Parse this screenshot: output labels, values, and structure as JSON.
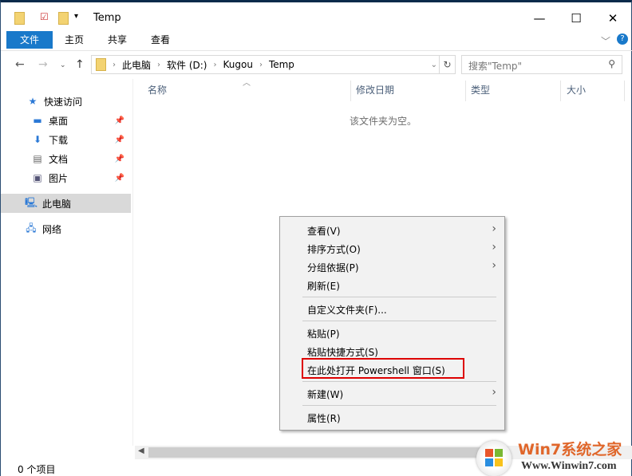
{
  "window": {
    "title": "Temp",
    "minimize": "—",
    "maximize": "☐",
    "close": "✕"
  },
  "ribbon": {
    "tabs": [
      "文件",
      "主页",
      "共享",
      "查看"
    ],
    "expand": "﹀",
    "help": "?"
  },
  "address": {
    "crumbs": [
      "此电脑",
      "软件 (D:)",
      "Kugou",
      "Temp"
    ],
    "search_placeholder": "搜索\"Temp\""
  },
  "sidebar": {
    "items": [
      {
        "label": "快速访问",
        "icon": "star-icon"
      },
      {
        "label": "桌面",
        "icon": "desktop-icon",
        "pinned": true
      },
      {
        "label": "下载",
        "icon": "download-icon",
        "pinned": true
      },
      {
        "label": "文档",
        "icon": "document-icon",
        "pinned": true
      },
      {
        "label": "图片",
        "icon": "pictures-icon",
        "pinned": true
      },
      {
        "label": "此电脑",
        "icon": "computer-icon",
        "selected": true
      },
      {
        "label": "网络",
        "icon": "network-icon"
      }
    ]
  },
  "columns": [
    "名称",
    "修改日期",
    "类型",
    "大小"
  ],
  "empty_text": "该文件夹为空。",
  "context_menu": {
    "items": [
      "查看(V)",
      "排序方式(O)",
      "分组依据(P)",
      "刷新(E)",
      "自定义文件夹(F)...",
      "粘贴(P)",
      "粘贴快捷方式(S)",
      "在此处打开 Powershell 窗口(S)",
      "新建(W)",
      "属性(R)"
    ]
  },
  "status": "0 个项目",
  "watermark": {
    "brand": "Win7系统之家",
    "url": "Www.Winwin7.com"
  }
}
